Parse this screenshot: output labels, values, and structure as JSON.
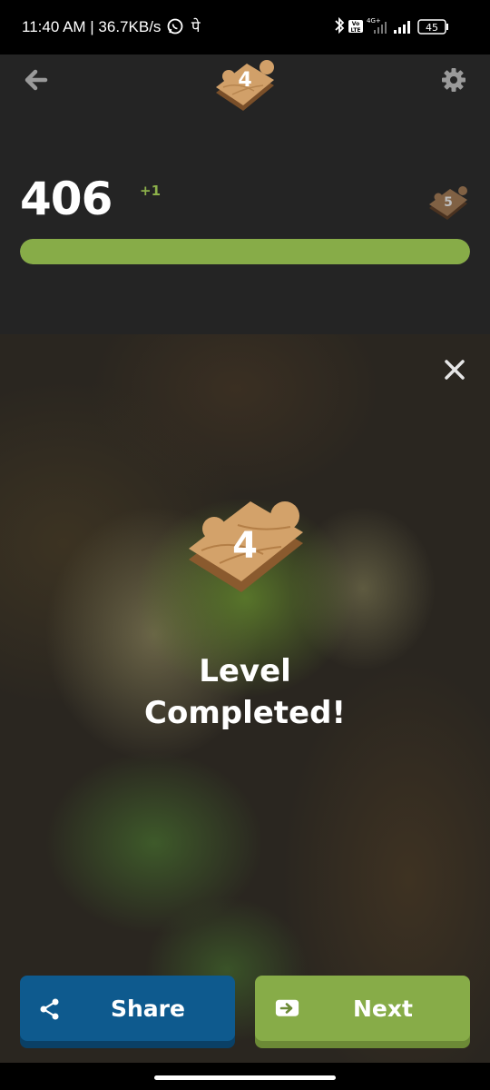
{
  "status_bar": {
    "left_text": "11:40 AM | 36.7KB/s",
    "extra_char": "पे",
    "network_label": "4G+",
    "volte_label": "Vo LTE",
    "battery": "45"
  },
  "header": {
    "current_level": "4",
    "back_icon": "arrow-left-icon",
    "settings_icon": "gear-icon"
  },
  "score": {
    "value": "406",
    "delta": "+1",
    "next_level": "5",
    "progress_fraction": 1.0
  },
  "overlay": {
    "level_badge": "4",
    "title_line1": "Level",
    "title_line2": "Completed!",
    "close_icon": "close-icon"
  },
  "actions": {
    "share_label": "Share",
    "next_label": "Next",
    "share_icon": "share-icon",
    "next_icon": "arrow-right-box-icon"
  },
  "colors": {
    "background": "#242424",
    "accent_green": "#87ac48",
    "share_blue": "#0e5a8e",
    "wood": "#c9955d"
  }
}
